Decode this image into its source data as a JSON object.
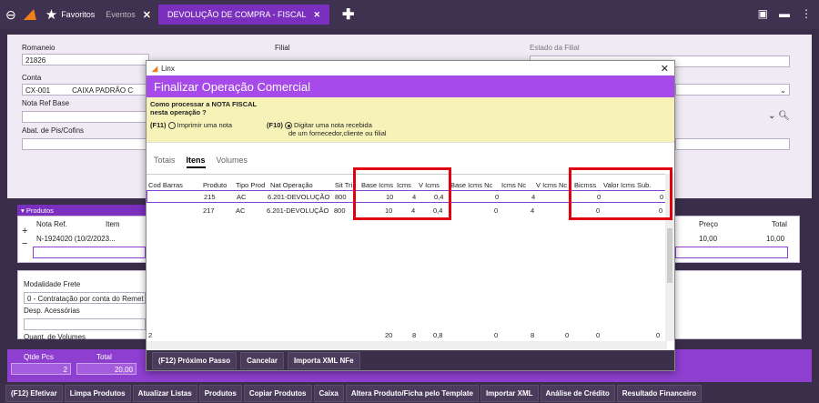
{
  "topbar": {
    "favoritos": "Favoritos",
    "eventos": "Eventos",
    "active_tab": "DEVOLUÇÃO DE COMPRA - FISCAL"
  },
  "form": {
    "romaneio_label": "Romaneio",
    "romaneio_value": "21826",
    "filial_label": "Filial",
    "estado_label": "Estado da Filial",
    "conta_label": "Conta",
    "conta_code": "CX-001",
    "conta_desc": "CAIXA PADRÃO C",
    "nota_ref_label": "Nota Ref Base",
    "abat_label": "Abat. de Pis/Cofins"
  },
  "produtos": {
    "header": "Produtos",
    "col_nota": "Nota Ref.",
    "col_item": "Item",
    "row1": "N-1924020 (10/2/2023...",
    "preco_label": "Preço",
    "total_label": "Total",
    "preco": "10,00",
    "total": "10,00"
  },
  "lower": {
    "modalidade_label": "Modalidade Frete",
    "modalidade_value": "0 - Contratação por conta do Remet",
    "desp_label": "Desp. Acessórias",
    "quant_label": "Quant. de Volumes"
  },
  "totals": {
    "qtde_label": "Qtde Pcs",
    "qtde": "2",
    "total_label": "Total",
    "total": "20,00"
  },
  "dialog": {
    "app": "Linx",
    "title": "Finalizar Operação Comercial",
    "question": "Como processar a NOTA FISCAL nesta operação ?",
    "opt1_key": "(F11)",
    "opt1": "Imprimir uma nota",
    "opt2_key": "(F10)",
    "opt2_line1": "Digitar uma nota recebida",
    "opt2_line2": "de um fornecedor,cliente ou filial",
    "tabs": [
      "Totais",
      "Itens",
      "Volumes"
    ],
    "columns": [
      "Cod Barras",
      "Produto",
      "Tipo Prod",
      "Nat Operação",
      "Sit Tri",
      "Base Icms",
      "Icms",
      "V Icms",
      "Base Icms Nc",
      "Icms Nc",
      "V Icms Nc",
      "Bicmss",
      "Valor Icms Sub."
    ],
    "rows": [
      {
        "produto": "215",
        "tipo": "AC",
        "nat": "6.201-DEVOLUÇÃO",
        "sit": "800",
        "base": "10",
        "icms": "4",
        "vicms": "0,4",
        "base_nc": "0",
        "icms_nc": "4",
        "bicmss": "0",
        "vsub": "0"
      },
      {
        "produto": "217",
        "tipo": "AC",
        "nat": "6.201-DEVOLUÇÃO",
        "sit": "800",
        "base": "10",
        "icms": "4",
        "vicms": "0,4",
        "base_nc": "0",
        "icms_nc": "4",
        "bicmss": "0",
        "vsub": "0"
      }
    ],
    "footer": {
      "count": "2",
      "base": "20",
      "icms": "8",
      "vicms": "0,8",
      "base_nc": "0",
      "icms_nc": "8",
      "vnc": "0",
      "bicmss": "0",
      "vsub": "0"
    },
    "buttons": [
      "(F12) Próximo Passo",
      "Cancelar",
      "Importa XML NFe"
    ]
  },
  "bottom_buttons": [
    "(F12) Efetivar",
    "Limpa Produtos",
    "Atualizar Listas",
    "Produtos",
    "Copiar Produtos",
    "Caixa",
    "Altera Produto/Ficha pelo Template",
    "Importar XML",
    "Análise de Crédito",
    "Resultado Financeiro"
  ],
  "colors": {
    "accent": "#8e3fd0",
    "highlight": "#e00012",
    "question_bg": "#f7f2b8"
  }
}
